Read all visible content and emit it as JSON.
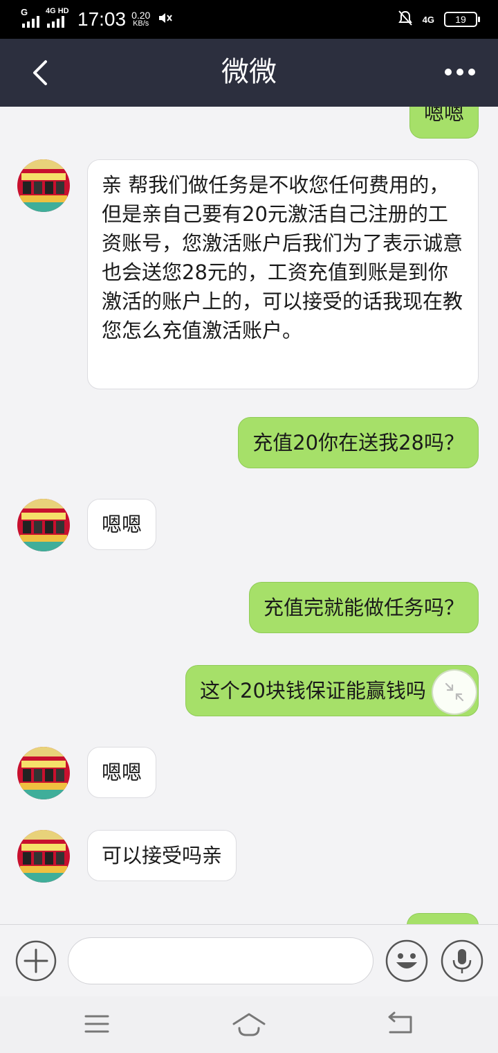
{
  "status_bar": {
    "signal1": "G",
    "signal2": "4G HD",
    "time": "17:03",
    "speed_value": "0.20",
    "speed_unit": "KB/s",
    "net": "4G",
    "battery": "19"
  },
  "header": {
    "title": "微微"
  },
  "messages": [
    {
      "side": "right",
      "text": "嗯嗯"
    },
    {
      "side": "left",
      "text": "亲 帮我们做任务是不收您任何费用的，但是亲自己要有20元激活自己注册的工资账号，您激活账户后我们为了表示诚意也会送您28元的，工资充值到账是到你激活的账户上的，可以接受的话我现在教您怎么充值激活账户。"
    },
    {
      "side": "right",
      "text": "充值20你在送我28吗？"
    },
    {
      "side": "left",
      "text": "嗯嗯"
    },
    {
      "side": "right",
      "text": "充值完就能做任务吗？"
    },
    {
      "side": "right",
      "text": "这个20块钱保证能赢钱吗"
    },
    {
      "side": "left",
      "text": "嗯嗯"
    },
    {
      "side": "left",
      "text": "可以接受吗亲"
    }
  ],
  "input": {
    "placeholder": ""
  },
  "icons": {
    "back": "chevron-left-icon",
    "more": "more-dots-icon",
    "plus": "plus-icon",
    "emoji": "emoji-icon",
    "voice": "microphone-icon",
    "float": "minimize-icon"
  },
  "colors": {
    "header_bg": "#2c2f3e",
    "bubble_right": "#a6e069",
    "bubble_left": "#ffffff"
  }
}
